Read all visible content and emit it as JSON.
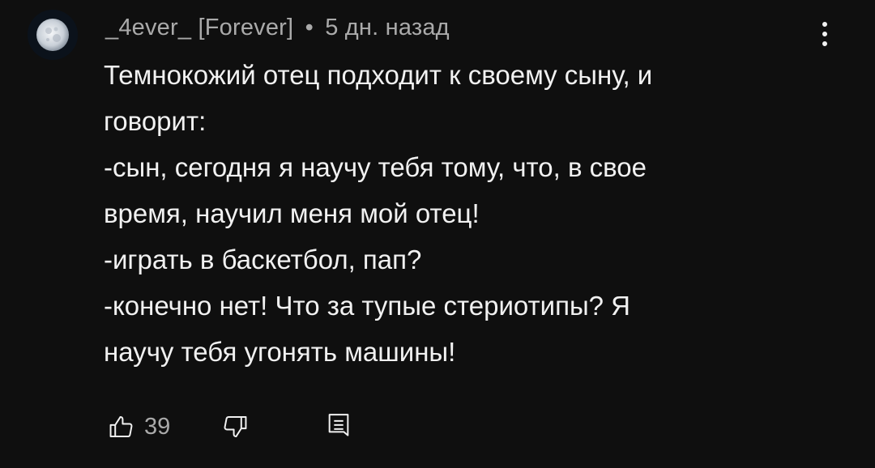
{
  "comment": {
    "author": "_4ever_ [Forever]",
    "separator": "•",
    "time": "5 дн. назад",
    "lines": [
      "Темнокожий отец подходит к своему сыну, и",
      "говорит:",
      "-сын, сегодня я научу тебя тому, что, в свое",
      "время, научил меня мой отец!",
      "-играть в баскетбол, пап?",
      "-конечно нет! Что за тупые стериотипы? Я",
      "научу тебя угонять машины!"
    ],
    "likes": "39"
  },
  "icons": {
    "avatar": "moon-avatar",
    "more": "more-vertical-icon",
    "like": "thumb-up-icon",
    "dislike": "thumb-down-icon",
    "reply": "reply-icon"
  },
  "colors": {
    "background": "#0f0f0f",
    "text": "#f1f1f1",
    "secondary": "#aaaaaa"
  }
}
